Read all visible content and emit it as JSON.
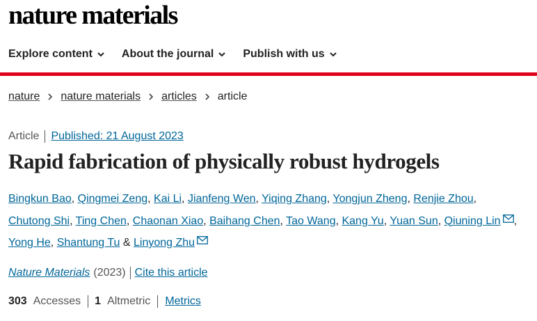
{
  "header": {
    "logo_text": "nature materials",
    "nav": [
      {
        "label": "Explore content"
      },
      {
        "label": "About the journal"
      },
      {
        "label": "Publish with us"
      }
    ]
  },
  "colors": {
    "accent_red": "#e0001b",
    "link_blue": "#006699",
    "text_dark": "#222222",
    "text_muted": "#555555"
  },
  "breadcrumb": {
    "items": [
      "nature",
      "nature materials",
      "articles"
    ],
    "current": "article"
  },
  "article": {
    "type": "Article",
    "published": "Published: 21 August 2023",
    "title": "Rapid fabrication of physically robust hydrogels",
    "authors": [
      "Bingkun Bao",
      "Qingmei Zeng",
      "Kai Li",
      "Jianfeng Wen",
      "Yiqing Zhang",
      "Yongjun Zheng",
      "Renjie Zhou",
      "Chutong Shi",
      "Ting Chen",
      "Chaonan Xiao",
      "Baihang Chen",
      "Tao Wang",
      "Kang Yu",
      "Yuan Sun",
      "Qiuning Lin",
      "Yong He",
      "Shantung Tu",
      "Linyong Zhu"
    ],
    "journal": "Nature Materials",
    "year": "(2023)",
    "cite_label": "Cite this article"
  },
  "metrics": {
    "accesses_count": "303",
    "accesses_label": "Accesses",
    "altmetric_count": "1",
    "altmetric_label": "Altmetric",
    "metrics_link": "Metrics"
  }
}
